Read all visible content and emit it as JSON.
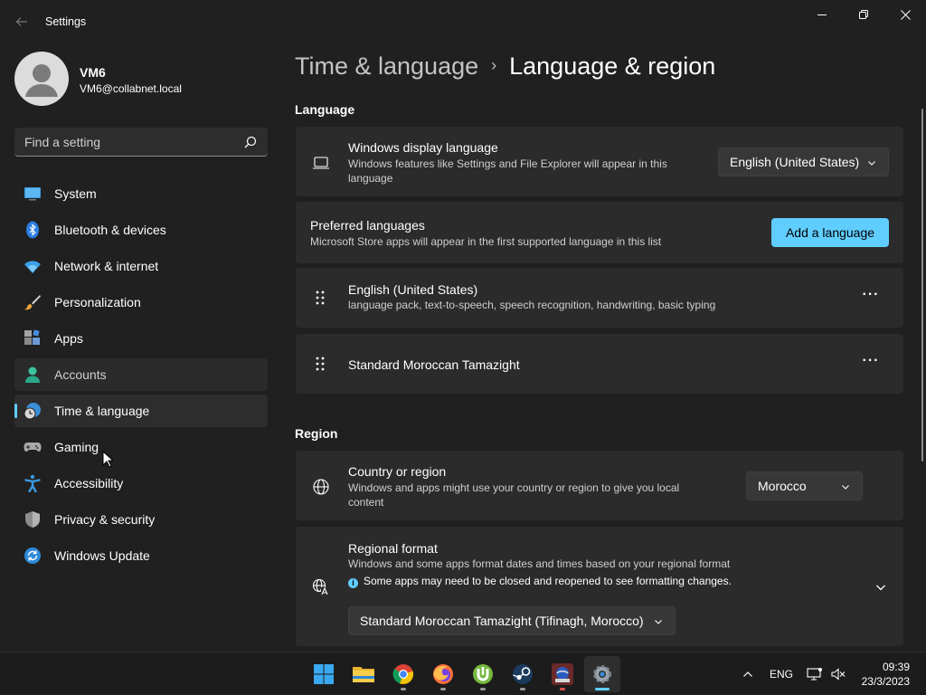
{
  "window": {
    "title": "Settings",
    "controls": {
      "minimize": "minimize-icon",
      "restore": "restore-icon",
      "close": "close-icon"
    }
  },
  "profile": {
    "name": "VM6",
    "email": "VM6@collabnet.local"
  },
  "search": {
    "placeholder": "Find a setting"
  },
  "sidebar": {
    "items": [
      {
        "label": "System",
        "icon": "system-display-icon"
      },
      {
        "label": "Bluetooth & devices",
        "icon": "bluetooth-icon"
      },
      {
        "label": "Network & internet",
        "icon": "wifi-icon"
      },
      {
        "label": "Personalization",
        "icon": "brush-icon"
      },
      {
        "label": "Apps",
        "icon": "apps-icon"
      },
      {
        "label": "Accounts",
        "icon": "accounts-icon"
      },
      {
        "label": "Time & language",
        "icon": "globe-clock-icon",
        "selected": true
      },
      {
        "label": "Gaming",
        "icon": "controller-icon"
      },
      {
        "label": "Accessibility",
        "icon": "accessibility-icon"
      },
      {
        "label": "Privacy & security",
        "icon": "shield-icon"
      },
      {
        "label": "Windows Update",
        "icon": "update-icon"
      }
    ]
  },
  "breadcrumb": {
    "parent": "Time & language",
    "separator": "›",
    "current": "Language & region"
  },
  "language_section": {
    "heading": "Language",
    "display_language": {
      "title": "Windows display language",
      "description": "Windows features like Settings and File Explorer will appear in this language",
      "value": "English (United States)"
    },
    "preferred": {
      "title": "Preferred languages",
      "description": "Microsoft Store apps will appear in the first supported language in this list",
      "button": "Add a language"
    },
    "languages": [
      {
        "name": "English (United States)",
        "features": "language pack, text-to-speech, speech recognition, handwriting, basic typing"
      },
      {
        "name": "Standard Moroccan Tamazight",
        "features": ""
      }
    ],
    "more_label": "···"
  },
  "region_section": {
    "heading": "Region",
    "country": {
      "title": "Country or region",
      "description": "Windows and apps might use your country or region to give you local content",
      "value": "Morocco"
    },
    "format": {
      "title": "Regional format",
      "description": "Windows and some apps format dates and times based on your regional format",
      "info": "Some apps may need to be closed and reopened to see formatting changes.",
      "value": "Standard Moroccan Tamazight (Tifinagh, Morocco)"
    }
  },
  "taskbar": {
    "apps": [
      "start-icon",
      "file-explorer-icon",
      "chrome-icon",
      "firefox-icon",
      "utorrent-icon",
      "steam-icon",
      "game-app-icon",
      "settings-icon"
    ],
    "language": "ENG",
    "time": "09:39",
    "date": "23/3/2023"
  },
  "colors": {
    "accent": "#60cdff",
    "background": "#202020",
    "card": "#2b2b2b",
    "taskbar": "#1c1c1c"
  }
}
